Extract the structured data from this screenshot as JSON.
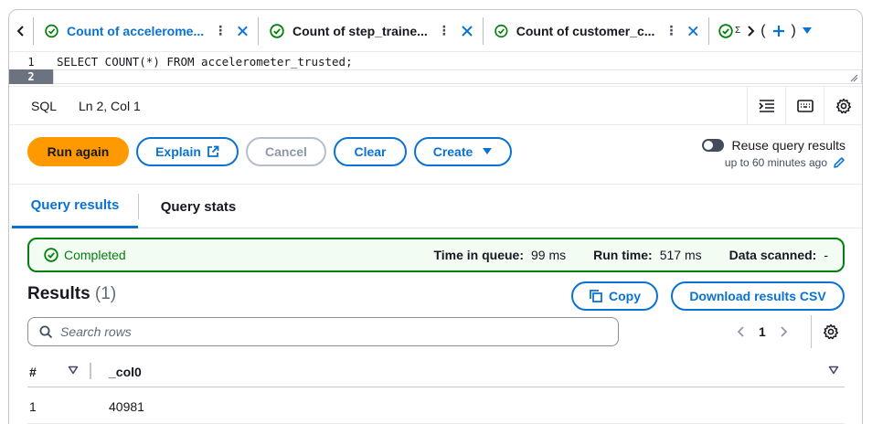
{
  "tabs": [
    {
      "label": "Count of accelerome...",
      "active": true
    },
    {
      "label": "Count of step_traine...",
      "active": false
    },
    {
      "label": "Count of customer_c...",
      "active": false
    }
  ],
  "tab_tail": {
    "partial": "Σ",
    "open_paren": "(",
    "close_paren": ")"
  },
  "editor": {
    "line1_no": "1",
    "line2_no": "2",
    "line1_code": "SELECT COUNT(*) FROM accelerometer_trusted;"
  },
  "status": {
    "language": "SQL",
    "position": "Ln 2, Col 1"
  },
  "actions": {
    "run_again": "Run again",
    "explain": "Explain",
    "cancel": "Cancel",
    "clear": "Clear",
    "create": "Create",
    "reuse_label": "Reuse query results",
    "reuse_sub": "up to 60 minutes ago"
  },
  "result_tabs": {
    "results": "Query results",
    "stats": "Query stats"
  },
  "banner": {
    "status": "Completed",
    "queue_label": "Time in queue:",
    "queue_value": "99 ms",
    "run_label": "Run time:",
    "run_value": "517 ms",
    "scanned_label": "Data scanned:",
    "scanned_value": "-"
  },
  "results": {
    "title": "Results",
    "count": "(1)",
    "copy": "Copy",
    "download": "Download results CSV",
    "search_placeholder": "Search rows",
    "page": "1"
  },
  "table": {
    "headers": {
      "index": "#",
      "col": "_col0"
    },
    "rows": [
      {
        "index": "1",
        "value": "40981"
      }
    ]
  },
  "colors": {
    "accent": "#0972d3",
    "primary": "#ff9900",
    "success": "#037f0c"
  }
}
